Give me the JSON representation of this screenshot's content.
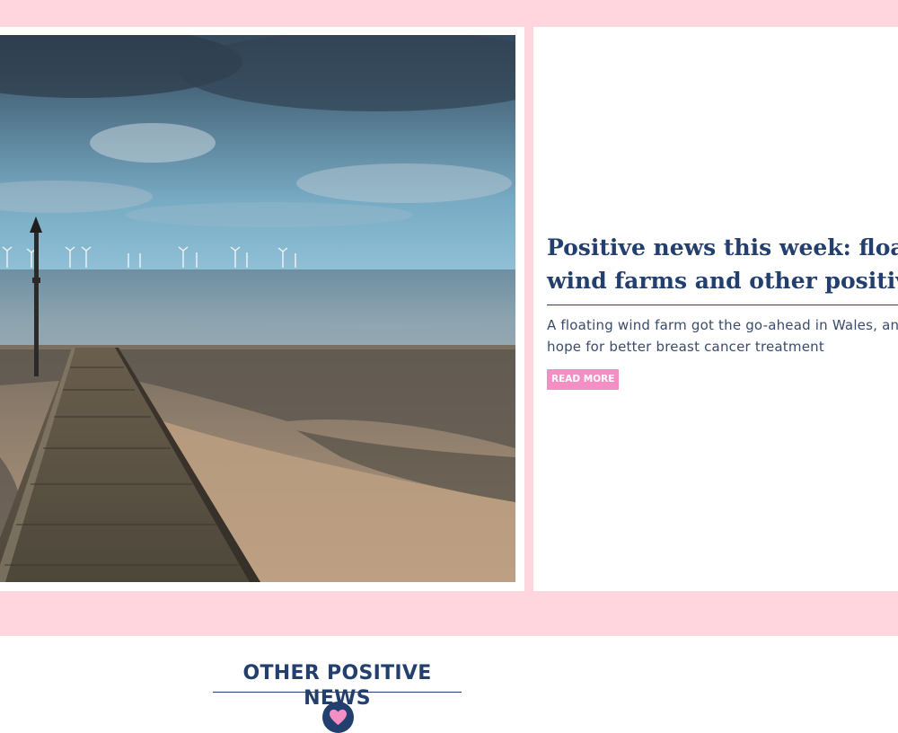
{
  "colors": {
    "band_pink": "#ffd6de",
    "navy": "#233f6e",
    "button_pink": "#f48fc5",
    "white": "#ffffff"
  },
  "feature": {
    "image": {
      "subject": "Wooden boardwalk leading onto a pebble beach toward the sea, with offshore wind turbines on the horizon under a cloudy sky"
    },
    "title": "Positive news this week: floating wind farms and other positive news",
    "excerpt": "A floating wind farm got the go-ahead in Wales, and a study offered hope for better breast cancer treatment",
    "read_more_label": "READ MORE"
  },
  "other_news": {
    "heading": "OTHER POSITIVE NEWS",
    "badge_icon": "heart-icon"
  }
}
